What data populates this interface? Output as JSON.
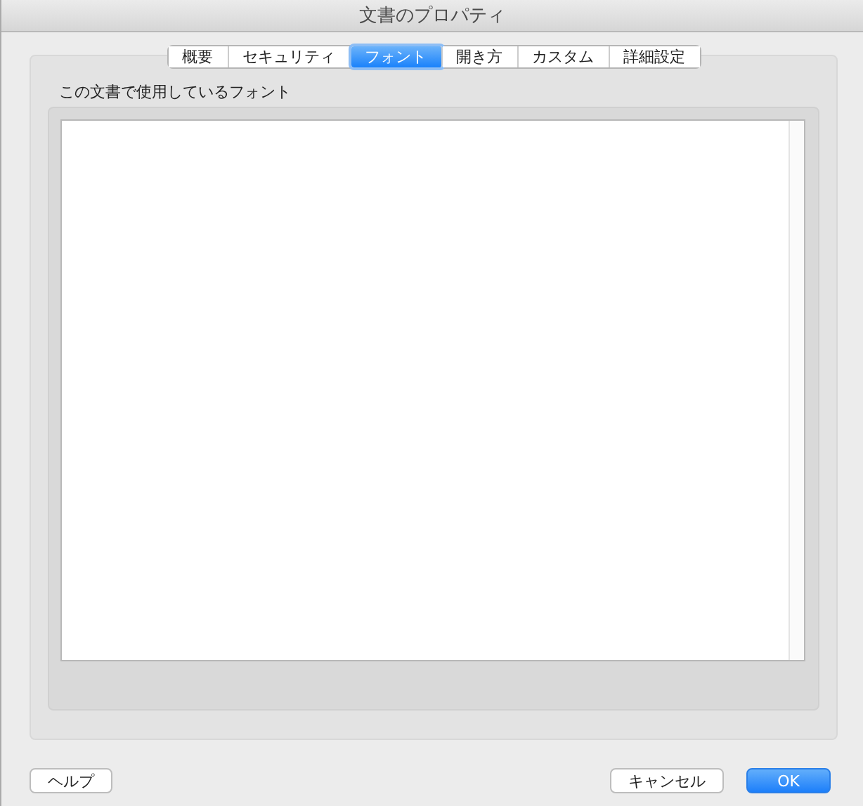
{
  "window": {
    "title": "文書のプロパティ"
  },
  "tabs": [
    {
      "label": "概要",
      "selected": false
    },
    {
      "label": "セキュリティ",
      "selected": false
    },
    {
      "label": "フォント",
      "selected": true
    },
    {
      "label": "開き方",
      "selected": false
    },
    {
      "label": "カスタム",
      "selected": false
    },
    {
      "label": "詳細設定",
      "selected": false
    }
  ],
  "fonts_panel": {
    "heading": "この文書で使用しているフォント"
  },
  "buttons_left": [
    {
      "label": "ヘルプ",
      "primary": false
    }
  ],
  "buttons_right": [
    {
      "label": "キャンセル",
      "primary": false
    },
    {
      "label": "OK",
      "primary": true
    }
  ]
}
